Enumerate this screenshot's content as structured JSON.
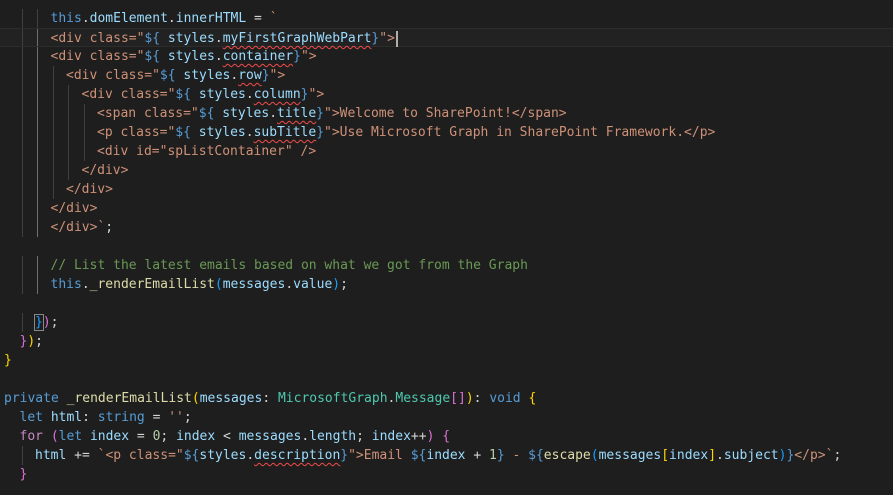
{
  "colors": {
    "background": "#1e1e1e",
    "keyword": "#569cd6",
    "string": "#ce9178",
    "property": "#9cdcfe",
    "function": "#dcdcaa",
    "type": "#4ec9b0",
    "comment": "#6a9955"
  },
  "lines": [
    {
      "indent": 3,
      "current": false,
      "tokens": [
        [
          "kw",
          "this"
        ],
        [
          "pl",
          "."
        ],
        [
          "prop",
          "domElement"
        ],
        [
          "pl",
          "."
        ],
        [
          "prop",
          "innerHTML"
        ],
        [
          "pl",
          " = "
        ],
        [
          "str",
          "`"
        ]
      ]
    },
    {
      "indent": 3,
      "current": true,
      "cursor": true,
      "tokens": [
        [
          "str",
          "<div class=\""
        ],
        [
          "kw",
          "${"
        ],
        [
          "pl",
          " "
        ],
        [
          "prop",
          "styles"
        ],
        [
          "pl",
          "."
        ],
        [
          "prop sq",
          "myFirstGraphWebPart"
        ],
        [
          "kw",
          "}"
        ],
        [
          "str",
          "\">"
        ]
      ]
    },
    {
      "indent": 3,
      "current": false,
      "tokens": [
        [
          "str",
          "<div class=\""
        ],
        [
          "kw",
          "${"
        ],
        [
          "pl",
          " "
        ],
        [
          "prop",
          "styles"
        ],
        [
          "pl",
          "."
        ],
        [
          "prop sq",
          "container"
        ],
        [
          "kw",
          "}"
        ],
        [
          "str",
          "\">"
        ]
      ]
    },
    {
      "indent": 4,
      "current": false,
      "tokens": [
        [
          "str",
          "<div class=\""
        ],
        [
          "kw",
          "${"
        ],
        [
          "pl",
          " "
        ],
        [
          "prop",
          "styles"
        ],
        [
          "pl",
          "."
        ],
        [
          "prop sq",
          "row"
        ],
        [
          "kw",
          "}"
        ],
        [
          "str",
          "\">"
        ]
      ]
    },
    {
      "indent": 5,
      "current": false,
      "tokens": [
        [
          "str",
          "<div class=\""
        ],
        [
          "kw",
          "${"
        ],
        [
          "pl",
          " "
        ],
        [
          "prop",
          "styles"
        ],
        [
          "pl",
          "."
        ],
        [
          "prop sq",
          "column"
        ],
        [
          "kw",
          "}"
        ],
        [
          "str",
          "\">"
        ]
      ]
    },
    {
      "indent": 6,
      "current": false,
      "tokens": [
        [
          "str",
          "<span class=\""
        ],
        [
          "kw",
          "${"
        ],
        [
          "pl",
          " "
        ],
        [
          "prop",
          "styles"
        ],
        [
          "pl",
          "."
        ],
        [
          "prop sq",
          "title"
        ],
        [
          "kw",
          "}"
        ],
        [
          "str",
          "\">Welcome to SharePoint!</span>"
        ]
      ]
    },
    {
      "indent": 6,
      "current": false,
      "tokens": [
        [
          "str",
          "<p class=\""
        ],
        [
          "kw",
          "${"
        ],
        [
          "pl",
          " "
        ],
        [
          "prop",
          "styles"
        ],
        [
          "pl",
          "."
        ],
        [
          "prop sq",
          "subTitle"
        ],
        [
          "kw",
          "}"
        ],
        [
          "str",
          "\">Use Microsoft Graph in SharePoint Framework.</p>"
        ]
      ]
    },
    {
      "indent": 6,
      "current": false,
      "tokens": [
        [
          "str",
          "<div id=\"spListContainer\" />"
        ]
      ]
    },
    {
      "indent": 5,
      "current": false,
      "tokens": [
        [
          "str",
          "</div>"
        ]
      ]
    },
    {
      "indent": 4,
      "current": false,
      "tokens": [
        [
          "str",
          "</div>"
        ]
      ]
    },
    {
      "indent": 3,
      "current": false,
      "tokens": [
        [
          "str",
          "</div>"
        ]
      ]
    },
    {
      "indent": 3,
      "current": false,
      "tokens": [
        [
          "str",
          "</div>`"
        ],
        [
          "pl",
          ";"
        ]
      ]
    },
    {
      "indent": 0,
      "current": false,
      "tokens": []
    },
    {
      "indent": 3,
      "current": false,
      "tokens": [
        [
          "cmt",
          "// List the latest emails based on what we got from the Graph"
        ]
      ]
    },
    {
      "indent": 3,
      "current": false,
      "tokens": [
        [
          "kw",
          "this"
        ],
        [
          "pl",
          "."
        ],
        [
          "fn",
          "_renderEmailList"
        ],
        [
          "b3",
          "("
        ],
        [
          "prop",
          "messages"
        ],
        [
          "pl",
          "."
        ],
        [
          "prop",
          "value"
        ],
        [
          "b3",
          ")"
        ],
        [
          "pl",
          ";"
        ]
      ]
    },
    {
      "indent": 0,
      "current": false,
      "tokens": []
    },
    {
      "indent": 2,
      "current": false,
      "tokens": [
        [
          "b3 match",
          "}"
        ],
        [
          "b2",
          ")"
        ],
        [
          "pl",
          ";"
        ]
      ]
    },
    {
      "indent": 1,
      "current": false,
      "tokens": [
        [
          "b2",
          "}"
        ],
        [
          "b1",
          ")"
        ],
        [
          "pl",
          ";"
        ]
      ]
    },
    {
      "indent": 0,
      "current": false,
      "tokens": [
        [
          "b1",
          "}"
        ]
      ]
    },
    {
      "indent": 0,
      "current": false,
      "tokens": []
    },
    {
      "indent": 0,
      "current": false,
      "tokens": [
        [
          "kw",
          "private"
        ],
        [
          "pl",
          " "
        ],
        [
          "fn",
          "_renderEmailList"
        ],
        [
          "b1",
          "("
        ],
        [
          "prop",
          "messages"
        ],
        [
          "pl",
          ": "
        ],
        [
          "typ",
          "MicrosoftGraph"
        ],
        [
          "pl",
          "."
        ],
        [
          "typ",
          "Message"
        ],
        [
          "b2",
          "[]"
        ],
        [
          "b1",
          ")"
        ],
        [
          "pl",
          ": "
        ],
        [
          "kw",
          "void"
        ],
        [
          "pl",
          " "
        ],
        [
          "b1",
          "{"
        ]
      ]
    },
    {
      "indent": 1,
      "current": false,
      "tokens": [
        [
          "kw",
          "let"
        ],
        [
          "pl",
          " "
        ],
        [
          "prop",
          "html"
        ],
        [
          "pl",
          ": "
        ],
        [
          "kw",
          "string"
        ],
        [
          "pl",
          " = "
        ],
        [
          "str",
          "''"
        ],
        [
          "pl",
          ";"
        ]
      ]
    },
    {
      "indent": 1,
      "current": false,
      "tokens": [
        [
          "ctl",
          "for"
        ],
        [
          "pl",
          " "
        ],
        [
          "b2",
          "("
        ],
        [
          "kw",
          "let"
        ],
        [
          "pl",
          " "
        ],
        [
          "prop",
          "index"
        ],
        [
          "pl",
          " = "
        ],
        [
          "num",
          "0"
        ],
        [
          "pl",
          "; "
        ],
        [
          "prop",
          "index"
        ],
        [
          "pl",
          " < "
        ],
        [
          "prop",
          "messages"
        ],
        [
          "pl",
          "."
        ],
        [
          "prop",
          "length"
        ],
        [
          "pl",
          "; "
        ],
        [
          "prop",
          "index"
        ],
        [
          "pl",
          "++"
        ],
        [
          "b2",
          ")"
        ],
        [
          "pl",
          " "
        ],
        [
          "b2",
          "{"
        ]
      ]
    },
    {
      "indent": 2,
      "current": false,
      "tokens": [
        [
          "prop",
          "html"
        ],
        [
          "pl",
          " += "
        ],
        [
          "str",
          "`<p class=\""
        ],
        [
          "kw",
          "${"
        ],
        [
          "prop",
          "styles"
        ],
        [
          "pl",
          "."
        ],
        [
          "prop sq",
          "description"
        ],
        [
          "kw",
          "}"
        ],
        [
          "str",
          "\">Email "
        ],
        [
          "kw",
          "${"
        ],
        [
          "prop",
          "index"
        ],
        [
          "pl",
          " + "
        ],
        [
          "num",
          "1"
        ],
        [
          "kw",
          "}"
        ],
        [
          "str",
          " - "
        ],
        [
          "kw",
          "${"
        ],
        [
          "fn",
          "escape"
        ],
        [
          "b3",
          "("
        ],
        [
          "prop",
          "messages"
        ],
        [
          "b1",
          "["
        ],
        [
          "prop",
          "index"
        ],
        [
          "b1",
          "]"
        ],
        [
          "pl",
          "."
        ],
        [
          "prop",
          "subject"
        ],
        [
          "b3",
          ")"
        ],
        [
          "kw",
          "}"
        ],
        [
          "str",
          "</p>`"
        ],
        [
          "pl",
          ";"
        ]
      ]
    },
    {
      "indent": 1,
      "current": false,
      "tokens": [
        [
          "b2",
          "}"
        ]
      ]
    }
  ]
}
